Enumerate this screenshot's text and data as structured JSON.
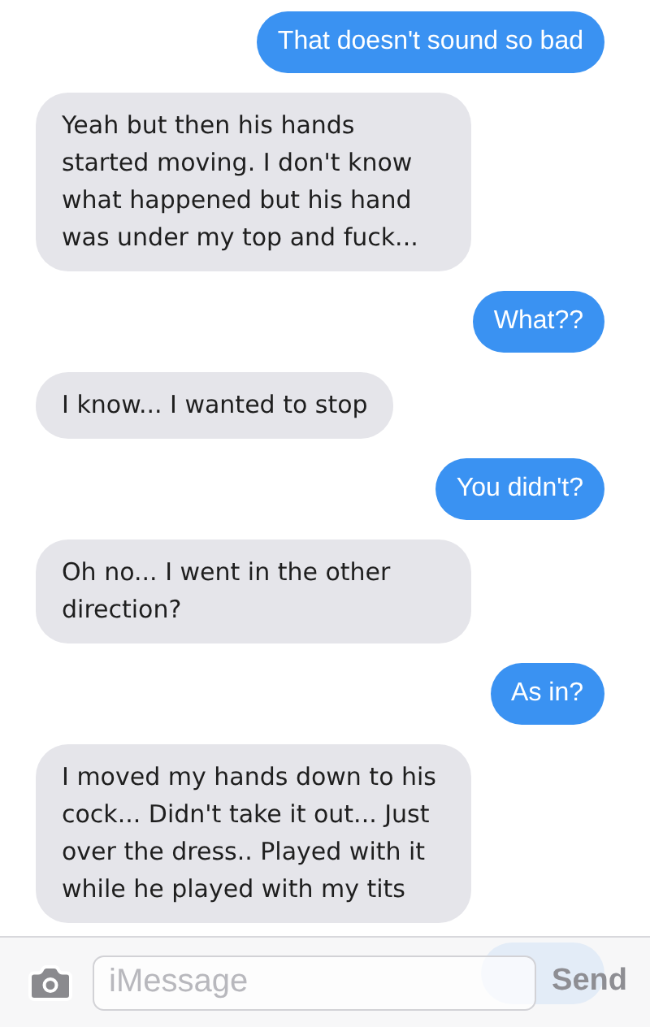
{
  "messages": [
    {
      "kind": "sent",
      "text": "That doesn't sound so bad"
    },
    {
      "kind": "received",
      "text": "Yeah but then his hands started moving. I don't know what happened but his hand was under my top and fuck..."
    },
    {
      "kind": "sent",
      "text": "What??"
    },
    {
      "kind": "received",
      "text": "I know... I wanted to stop"
    },
    {
      "kind": "sent",
      "text": "You didn't?"
    },
    {
      "kind": "received",
      "text": "Oh no... I went in the other direction?"
    },
    {
      "kind": "sent",
      "text": "As in?"
    },
    {
      "kind": "received",
      "text": "I moved my hands down to his cock... Didn't take it out... Just over the dress.. Played with it while he played with  my tits"
    },
    {
      "kind": "covered"
    }
  ],
  "composer": {
    "placeholder": "iMessage",
    "send": "Send"
  }
}
